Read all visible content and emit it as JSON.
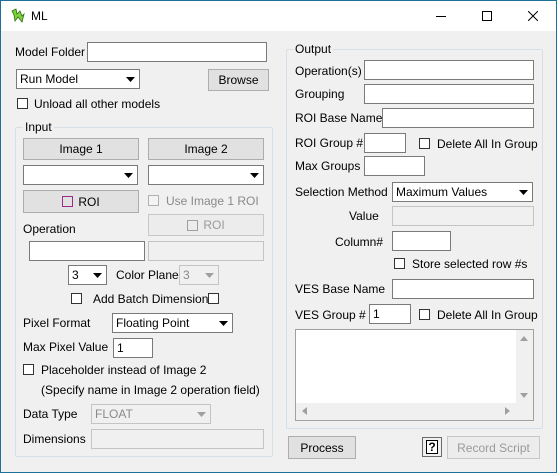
{
  "window": {
    "title": "ML"
  },
  "colors": {
    "accent": "#1f6f99",
    "roi_icon": "#9c2a8a"
  },
  "model_folder": {
    "label": "Model Folder",
    "value": ""
  },
  "run_mode": {
    "selected": "Run Model"
  },
  "browse_label": "Browse",
  "unload_label": "Unload all other models",
  "input": {
    "group_label": "Input",
    "image1_label": "Image 1",
    "image2_label": "Image 2",
    "image1_select": "",
    "image2_select": "",
    "roi1_label": "ROI",
    "use_image1_roi_label": "Use Image 1 ROI",
    "roi2_label": "ROI",
    "operation_label": "Operation",
    "operation_value": "",
    "operation2_value": "",
    "color_planes_value": "3",
    "color_planes_label": "Color Planes",
    "color_planes2_value": "3",
    "add_batch_label": "Add Batch Dimension",
    "pixel_format_label": "Pixel Format",
    "pixel_format_value": "Floating Point",
    "max_pixel_label": "Max Pixel Value",
    "max_pixel_value": "1",
    "placeholder_label": "Placeholder instead of Image 2",
    "placeholder_note": "(Specify name in Image 2 operation field)",
    "data_type_label": "Data Type",
    "data_type_value": "FLOAT",
    "dimensions_label": "Dimensions",
    "dimensions_value": ""
  },
  "output": {
    "group_label": "Output",
    "operations_label": "Operation(s)",
    "operations_value": "",
    "grouping_label": "Grouping",
    "grouping_value": "",
    "roi_base_label": "ROI Base Name",
    "roi_base_value": "",
    "roi_group_label": "ROI Group #",
    "roi_group_value": "",
    "delete_all_roi_label": "Delete All In Group",
    "max_groups_label": "Max Groups",
    "max_groups_value": "",
    "selection_method_label": "Selection Method",
    "selection_method_value": "Maximum Values",
    "value_label": "Value",
    "value_value": "",
    "column_label": "Column#",
    "column_value": "",
    "store_row_label": "Store selected row #s",
    "ves_base_label": "VES Base Name",
    "ves_base_value": "",
    "ves_group_label": "VES Group #",
    "ves_group_value": "1",
    "delete_all_ves_label": "Delete All In Group"
  },
  "process_label": "Process",
  "help_label": "?",
  "record_script_label": "Record Script"
}
